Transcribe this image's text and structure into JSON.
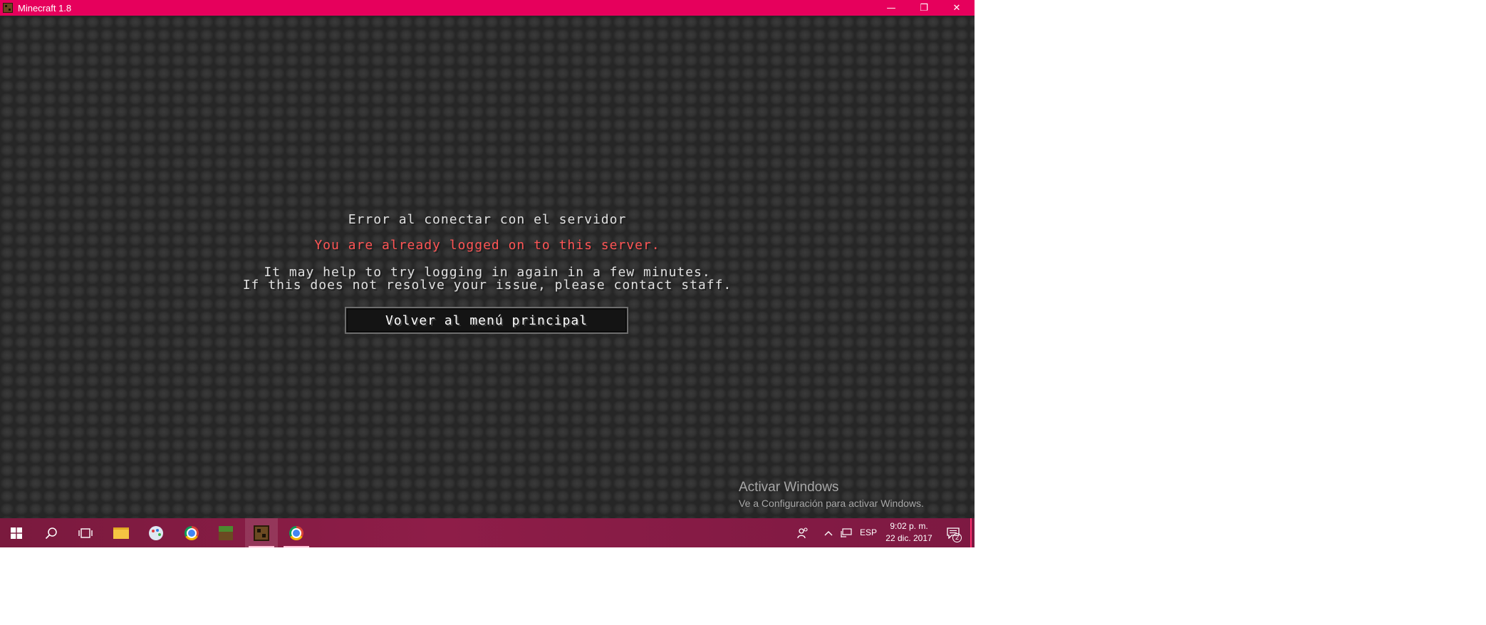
{
  "window": {
    "title": "Minecraft 1.8",
    "controls": {
      "minimize": "—",
      "restore": "❐",
      "close": "✕"
    }
  },
  "game": {
    "error_title": "Error al conectar con el servidor",
    "error_message": "You are already logged on to this server.",
    "help_line1": "It may help to try logging in again in a few minutes.",
    "help_line2": "If this does not resolve your issue, please contact staff.",
    "back_button": "Volver al menú principal"
  },
  "watermark": {
    "title": "Activar Windows",
    "subtitle": "Ve a Configuración para activar Windows."
  },
  "taskbar": {
    "apps": [
      "start-icon",
      "search-icon",
      "task-view-icon",
      "file-explorer-icon",
      "paint-icon",
      "chrome-icon",
      "minecraft-grass-icon",
      "minecraft-icon",
      "chrome-icon"
    ],
    "active_app": "minecraft-icon",
    "tray": {
      "language": "ESP",
      "time": "9:02 p. m.",
      "date": "22 dic. 2017",
      "notifications": "2"
    }
  },
  "colors": {
    "title_bar": "#e6005c",
    "error_text": "#ff5555",
    "taskbar": "#8e1d48"
  }
}
